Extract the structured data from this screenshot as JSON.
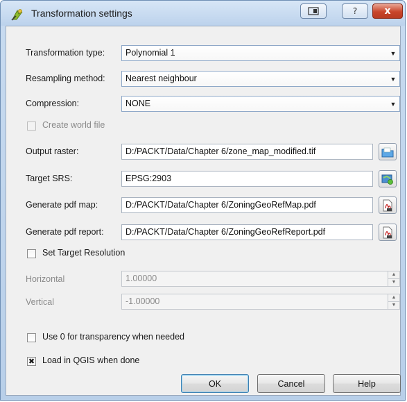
{
  "window": {
    "title": "Transformation settings",
    "help_glyph": "?",
    "close_glyph": "x"
  },
  "form": {
    "transformation_type": {
      "label": "Transformation type:",
      "value": "Polynomial 1"
    },
    "resampling_method": {
      "label": "Resampling method:",
      "value": "Nearest neighbour"
    },
    "compression": {
      "label": "Compression:",
      "value": "NONE"
    },
    "create_world_file": {
      "label": "Create world file",
      "checked": false,
      "enabled": false
    },
    "output_raster": {
      "label": "Output raster:",
      "value": "D:/PACKT/Data/Chapter 6/zone_map_modified.tif",
      "button_icon": "open-file-icon"
    },
    "target_srs": {
      "label": "Target SRS:",
      "value": "EPSG:2903",
      "button_icon": "projection-globe-icon"
    },
    "pdf_map": {
      "label": "Generate pdf map:",
      "value": "D:/PACKT/Data/Chapter 6/ZoningGeoRefMap.pdf",
      "button_icon": "pdf-file-icon"
    },
    "pdf_report": {
      "label": "Generate pdf report:",
      "value": "D:/PACKT/Data/Chapter 6/ZoningGeoRefReport.pdf",
      "button_icon": "pdf-file-icon"
    },
    "set_target_resolution": {
      "label": "Set Target Resolution",
      "checked": false
    },
    "horizontal": {
      "label": "Horizontal",
      "value": "1.00000"
    },
    "vertical": {
      "label": "Vertical",
      "value": "-1.00000"
    },
    "use_zero_transparency": {
      "label": "Use 0 for transparency when needed",
      "checked": false
    },
    "load_in_qgis": {
      "label": "Load in QGIS when done",
      "checked": true,
      "mark": "✖"
    }
  },
  "buttons": {
    "ok": "OK",
    "cancel": "Cancel",
    "help": "Help"
  },
  "colors": {
    "titlebar": "#bcd2ec",
    "close_button": "#c9452b",
    "dialog_bg": "#f0f0f0"
  }
}
